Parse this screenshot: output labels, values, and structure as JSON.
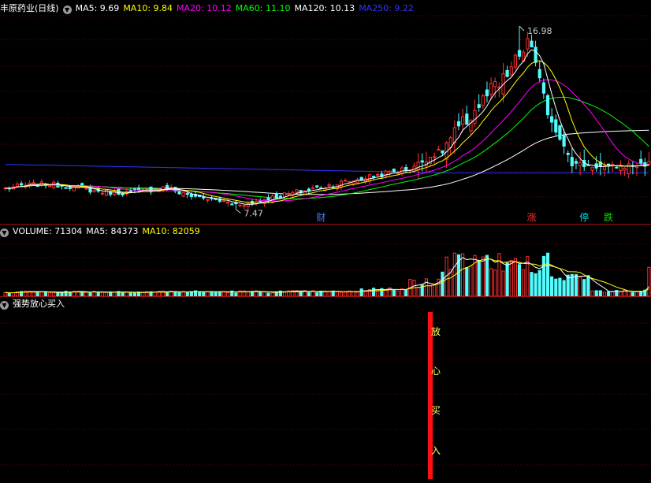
{
  "header": {
    "stock": "丰原药业(日线)",
    "ma": [
      {
        "label": "MA5: 9.69",
        "color": "#ffffff"
      },
      {
        "label": "MA10: 9.84",
        "color": "#ffff00"
      },
      {
        "label": "MA20: 10.12",
        "color": "#ff00ff"
      },
      {
        "label": "MA60: 11.10",
        "color": "#00ff00"
      },
      {
        "label": "MA120: 10.13",
        "color": "#ffffff"
      },
      {
        "label": "MA250: 9.22",
        "color": "#3333ff"
      }
    ]
  },
  "volume_header": {
    "items": [
      {
        "label": "VOLUME: 71304",
        "color": "#ffffff"
      },
      {
        "label": "MA5: 84373",
        "color": "#ffffff"
      },
      {
        "label": "MA10: 82059",
        "color": "#ffff00"
      }
    ]
  },
  "indicator_header": {
    "title": "强势放心买入"
  },
  "colors": {
    "up": "#ff3030",
    "down": "#54fcfc",
    "grid": "#7a0000",
    "divider": "#a01010"
  },
  "chart_data": [
    {
      "type": "candlestick",
      "title": "丰原药业(日线)",
      "ylim": [
        6.8,
        17.6
      ],
      "grid": true,
      "annotations": [
        {
          "text": "16.98",
          "type": "high"
        },
        {
          "text": "7.47",
          "type": "low"
        }
      ],
      "markers": [
        {
          "text": "财",
          "color": "#4d79ff"
        },
        {
          "text": "涨",
          "color": "#ff3030"
        },
        {
          "text": "停",
          "color": "#00e0e0"
        },
        {
          "text": "跌",
          "color": "#00e000"
        }
      ],
      "series": [
        {
          "name": "MA5",
          "color": "#ffffff"
        },
        {
          "name": "MA10",
          "color": "#ffff00"
        },
        {
          "name": "MA20",
          "color": "#ff00ff"
        },
        {
          "name": "MA60",
          "color": "#00ff00"
        },
        {
          "name": "MA120",
          "color": "#ffffff"
        },
        {
          "name": "MA250",
          "color": "#3333ff"
        }
      ]
    },
    {
      "type": "bar",
      "title": "VOLUME",
      "ylim": [
        0,
        140000
      ]
    },
    {
      "type": "bar",
      "title": "强势放心买入",
      "signal_text": [
        "放",
        "心",
        "买",
        "入"
      ]
    }
  ]
}
